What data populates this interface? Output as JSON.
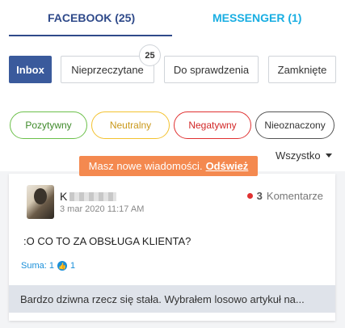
{
  "tabs": {
    "facebook": "FACEBOOK (25)",
    "messenger": "MESSENGER (1)"
  },
  "folders": {
    "inbox": "Inbox",
    "unread": "Nieprzeczytane",
    "unread_badge": "25",
    "to_check": "Do sprawdzenia",
    "closed": "Zamknięte"
  },
  "sentiment_filters": {
    "positive": "Pozytywny",
    "neutral": "Neutralny",
    "negative": "Negatywny",
    "unknown": "Nieoznaczony"
  },
  "filter": {
    "selected": "Wszystko"
  },
  "notice": {
    "text": "Masz nowe wiadomości.",
    "link": "Odśwież"
  },
  "post": {
    "author_initial": "K",
    "date": "3 mar 2020 11:17 AM",
    "comment_count": "3",
    "comment_label": "Komentarze",
    "text": ":O CO TO ZA OBSŁUGA KLIENTA?",
    "sum_label": "Suma: 1",
    "likes": "1",
    "reply_preview": "Bardzo dziwna rzecz się stała. Wybrałem losowo artykuł na..."
  },
  "colors": {
    "brand_blue": "#3a5a9c",
    "messenger_blue": "#19aee2",
    "notice_orange": "#f4894f",
    "negative_red": "#e03131"
  }
}
